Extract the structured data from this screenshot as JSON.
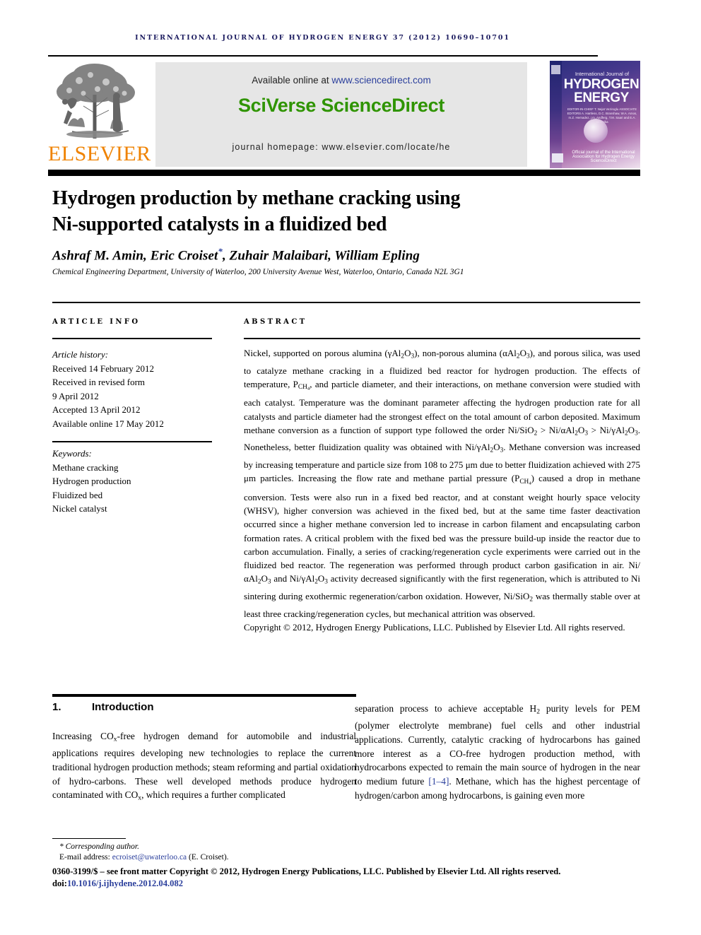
{
  "running_head": "International Journal of Hydrogen Energy 37 (2012) 10690–10701",
  "masthead": {
    "publisher_name": "ELSEVIER",
    "available_prefix": "Available online at ",
    "available_url": "www.sciencedirect.com",
    "platform": "SciVerse ScienceDirect",
    "homepage": "journal homepage: www.elsevier.com/locate/he",
    "cover": {
      "kicker": "International Journal of",
      "line1": "HYDROGEN",
      "line2": "ENERGY",
      "editors": "EDITOR-IN-CHIEF  T. Nejat Veziroglu\nASSOCIATE EDITORS  A. Hartless, D.C. Branshaw, W.A. Amos,\nm.Z. Hernadez, j.m. Andferg,\nT.M. Saari and E.A. Veronika",
      "footer": "Official journal of the International Association for Hydrogen Energy\nScienceDirect"
    },
    "colors": {
      "banner_bg": "#e6e6e6",
      "sciverse_green": "#2f9400",
      "link_blue": "#2b3f9c",
      "elsevier_orange": "#ef8200"
    }
  },
  "article": {
    "title_line1": "Hydrogen production by methane cracking using",
    "title_line2": "Ni-supported catalysts in a fluidized bed",
    "authors": "Ashraf M. Amin, Eric Croiset",
    "corresponding_marker": "*",
    "authors_rest": ", Zuhair Malaibari, William Epling",
    "affiliation": "Chemical Engineering Department, University of Waterloo, 200 University Avenue West, Waterloo, Ontario, Canada N2L 3G1"
  },
  "article_info": {
    "heading": "ARTICLE INFO",
    "history_label": "Article history:",
    "history": [
      "Received 14 February 2012",
      "Received in revised form",
      "9 April 2012",
      "Accepted 13 April 2012",
      "Available online 17 May 2012"
    ],
    "keywords_label": "Keywords:",
    "keywords": [
      "Methane cracking",
      "Hydrogen production",
      "Fluidized bed",
      "Nickel catalyst"
    ]
  },
  "abstract": {
    "heading": "ABSTRACT",
    "body_html": "Nickel, supported on porous alumina (γAl<sub>2</sub>O<sub>3</sub>), non-porous alumina (αAl<sub>2</sub>O<sub>3</sub>), and porous silica, was used to catalyze methane cracking in a fluidized bed reactor for hydrogen production. The effects of temperature, P<sub>CH<sub>4</sub></sub>, and particle diameter, and their interactions, on methane conversion were studied with each catalyst. Temperature was the dominant parameter affecting the hydrogen production rate for all catalysts and particle diameter had the strongest effect on the total amount of carbon deposited. Maximum methane conversion as a function of support type followed the order Ni/SiO<sub>2</sub> &gt; Ni/αAl<sub>2</sub>O<sub>3</sub> &gt; Ni/γAl<sub>2</sub>O<sub>3</sub>. Nonetheless, better fluidization quality was obtained with Ni/γAl<sub>2</sub>O<sub>3</sub>. Methane conversion was increased by increasing temperature and particle size from 108 to 275 μm due to better fluidization achieved with 275 μm particles. Increasing the flow rate and methane partial pressure (P<sub>CH<sub>4</sub></sub>) caused a drop in methane conversion. Tests were also run in a fixed bed reactor, and at constant weight hourly space velocity (WHSV), higher conversion was achieved in the fixed bed, but at the same time faster deactivation occurred since a higher methane conversion led to increase in carbon filament and encapsulating carbon formation rates. A critical problem with the fixed bed was the pressure build-up inside the reactor due to carbon accumulation. Finally, a series of cracking/regeneration cycle experiments were carried out in the fluidized bed reactor. The regeneration was performed through product carbon gasification in air. Ni/αAl<sub>2</sub>O<sub>3</sub> and Ni/γAl<sub>2</sub>O<sub>3</sub> activity decreased significantly with the first regeneration, which is attributed to Ni sintering during exothermic regeneration/carbon oxidation. However, Ni/SiO<sub>2</sub> was thermally stable over at least three cracking/regeneration cycles, but mechanical attrition was observed.",
    "copyright": "Copyright © 2012, Hydrogen Energy Publications, LLC. Published by Elsevier Ltd. All rights reserved."
  },
  "body": {
    "section_number": "1.",
    "section_title": "Introduction",
    "left_column_html": "Increasing CO<sub>x</sub>-free hydrogen demand for automobile and industrial applications requires developing new technologies to replace the current traditional hydrogen production methods; steam reforming and partial oxidation of hydro-carbons. These well developed methods produce hydrogen contaminated with CO<sub>x</sub>, which requires a further complicated",
    "right_column_html": "separation process to achieve acceptable H<sub>2</sub> purity levels for PEM (polymer electrolyte membrane) fuel cells and other industrial applications. Currently, catalytic cracking of hydrocarbons has gained more interest as a CO-free hydrogen production method, with hydrocarbons expected to remain the main source of hydrogen in the near to medium future <span class=\"ref-link\">[1–4]</span>. Methane, which has the highest percentage of hydrogen/carbon among hydrocarbons, is gaining even more"
  },
  "footer": {
    "corresponding": "* Corresponding author.",
    "email_label": "E-mail address: ",
    "email": "ecroiset@uwaterloo.ca",
    "email_suffix": " (E. Croiset).",
    "issn_line": "0360-3199/$ – see front matter Copyright © 2012, Hydrogen Energy Publications, LLC. Published by Elsevier Ltd. All rights reserved.",
    "doi_label": "doi:",
    "doi_value": "10.1016/j.ijhydene.2012.04.082"
  }
}
